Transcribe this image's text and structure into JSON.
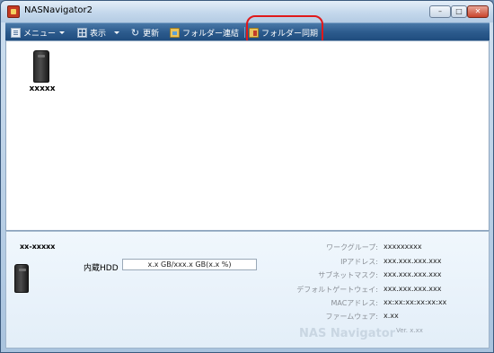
{
  "window": {
    "title": "NASNavigator2"
  },
  "toolbar": {
    "menu_label": "メニュー",
    "view_label": "表示",
    "refresh_label": "更新",
    "folder_link_label": "フォルダー連結",
    "folder_sync_label": "フォルダー同期"
  },
  "devices": [
    {
      "name": "xxxxx"
    }
  ],
  "info": {
    "device_name": "xx-xxxxx",
    "hdd_label": "内蔵HDD",
    "hdd_usage": "x.x GB/xxx.x GB(x.x %)",
    "network": [
      {
        "label": "ワークグループ:",
        "value": "xxxxxxxxx"
      },
      {
        "label": "IPアドレス:",
        "value": "xxx.xxx.xxx.xxx"
      },
      {
        "label": "サブネットマスク:",
        "value": "xxx.xxx.xxx.xxx"
      },
      {
        "label": "デフォルトゲートウェイ:",
        "value": "xxx.xxx.xxx.xxx"
      },
      {
        "label": "MACアドレス:",
        "value": "xx:xx:xx:xx:xx:xx"
      },
      {
        "label": "ファームウェア:",
        "value": "x.xx"
      }
    ],
    "brand": "NAS Navigator",
    "version": "Ver. x.xx"
  },
  "colors": {
    "toolbar": "#2d5c8e",
    "highlight": "#e0191b",
    "panel": "#e3eef8"
  }
}
